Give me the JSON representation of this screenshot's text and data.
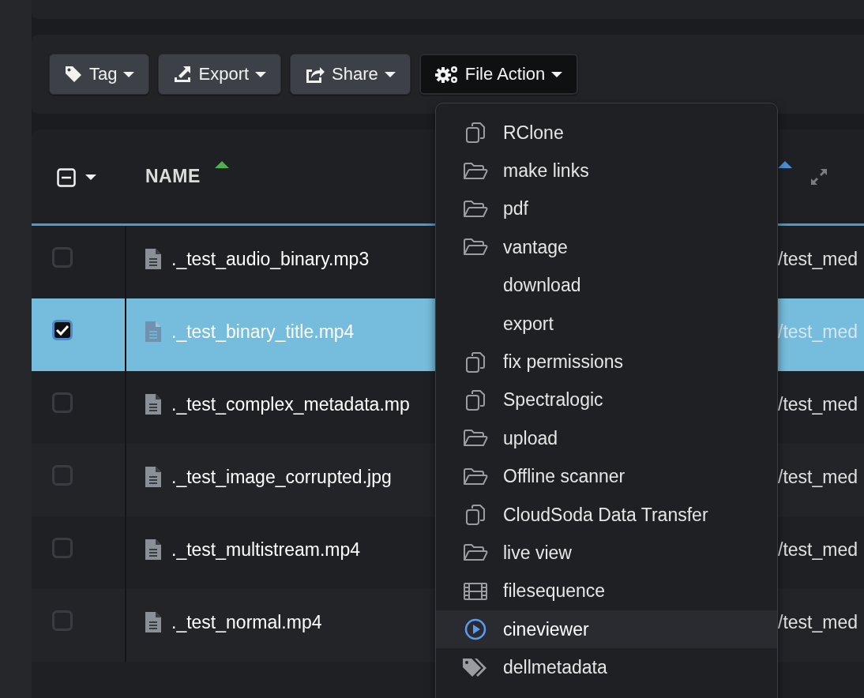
{
  "toolbar": {
    "buttons": [
      {
        "label": "Tag",
        "kind": "tag",
        "active": false
      },
      {
        "label": "Export",
        "kind": "export",
        "active": false
      },
      {
        "label": "Share",
        "kind": "share",
        "active": false
      },
      {
        "label": "File Action",
        "kind": "gears",
        "active": true
      }
    ]
  },
  "table": {
    "select_all": {
      "indeterminate": true
    },
    "columns": [
      {
        "label": "NAME",
        "sorted": true,
        "color": "#4caf50"
      },
      {
        "sorted": true,
        "color": "#4a90d0"
      }
    ],
    "rows": [
      {
        "name": "._test_audio_binary.mp3",
        "path": "/test_med",
        "selected": false
      },
      {
        "name": "._test_binary_title.mp4",
        "path": "/test_med",
        "selected": true
      },
      {
        "name": "._test_complex_metadata.mp",
        "path": "/test_med",
        "selected": false
      },
      {
        "name": "._test_image_corrupted.jpg",
        "path": "/test_med",
        "selected": false
      },
      {
        "name": "._test_multistream.mp4",
        "path": "/test_med",
        "selected": false
      },
      {
        "name": "._test_normal.mp4",
        "path": "/test_med",
        "selected": false
      }
    ]
  },
  "file_action_menu": {
    "items": [
      {
        "label": "RClone",
        "kind": "copy",
        "hovered": false
      },
      {
        "label": "make links",
        "kind": "folder",
        "hovered": false
      },
      {
        "label": "pdf",
        "kind": "folder",
        "hovered": false
      },
      {
        "label": "vantage",
        "kind": "folder",
        "hovered": false
      },
      {
        "label": "download",
        "kind": "plain",
        "hovered": false
      },
      {
        "label": "export",
        "kind": "plain",
        "hovered": false
      },
      {
        "label": "fix permissions",
        "kind": "copy",
        "hovered": false
      },
      {
        "label": "Spectralogic",
        "kind": "copy",
        "hovered": false
      },
      {
        "label": "upload",
        "kind": "folder",
        "hovered": false
      },
      {
        "label": "Offline scanner",
        "kind": "folder",
        "hovered": false
      },
      {
        "label": "CloudSoda Data Transfer",
        "kind": "copy",
        "hovered": false
      },
      {
        "label": "live view",
        "kind": "folder",
        "hovered": false
      },
      {
        "label": "filesequence",
        "kind": "film",
        "hovered": false
      },
      {
        "label": "cineviewer",
        "kind": "play",
        "hovered": true
      },
      {
        "label": "dellmetadata",
        "kind": "tags",
        "hovered": false
      }
    ]
  }
}
